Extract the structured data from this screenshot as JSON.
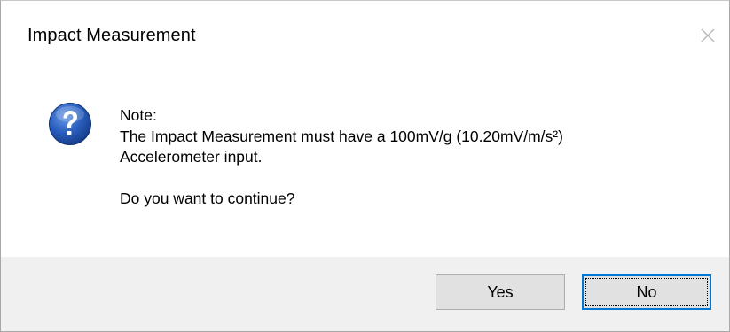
{
  "window": {
    "title": "Impact Measurement"
  },
  "icons": {
    "message_icon": "question-icon",
    "close_icon": "close-icon"
  },
  "message": {
    "line1": "Note:",
    "line2": "The Impact Measurement must have a 100mV/g (10.20mV/m/s²)",
    "line3": "Accelerometer input.",
    "line4": "Do you want to continue?"
  },
  "buttons": {
    "yes_label": "Yes",
    "no_label": "No",
    "default": "No"
  },
  "colors": {
    "focus_border": "#0078d7",
    "icon_blue": "#1f56b3",
    "footer_bg": "#f0f0f0"
  }
}
